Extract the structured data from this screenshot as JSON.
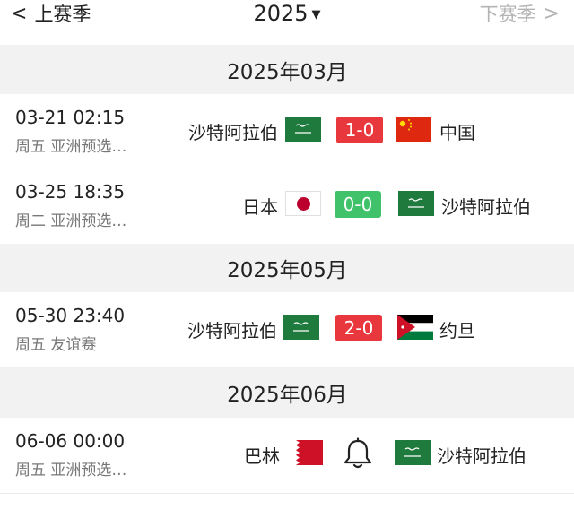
{
  "header": {
    "prev_label": "上赛季",
    "year": "2025",
    "next_label": "下赛季",
    "prev_icon": "chevron-left-icon",
    "next_icon": "chevron-right-icon",
    "year_icon": "caret-down-icon"
  },
  "months": [
    "2025年03月",
    "2025年05月",
    "2025年06月"
  ],
  "matches": [
    {
      "datetime": "03-21 02:15",
      "info": "周五 亚洲预选…",
      "home": "沙特阿拉伯",
      "score": "1-0",
      "away": "中国"
    },
    {
      "datetime": "03-25 18:35",
      "info": "周二 亚洲预选…",
      "home": "日本",
      "score": "0-0",
      "away": "沙特阿拉伯"
    },
    {
      "datetime": "05-30 23:40",
      "info": "周五 友谊赛",
      "home": "沙特阿拉伯",
      "score": "2-0",
      "away": "约旦"
    },
    {
      "datetime": "06-06 00:00",
      "info": "周五 亚洲预选…",
      "home": "巴林",
      "away": "沙特阿拉伯",
      "status_icon": "bell-icon"
    }
  ],
  "colors": {
    "loss": "#e8383d",
    "draw": "#3fc26a",
    "muted": "#b4b4b4"
  }
}
